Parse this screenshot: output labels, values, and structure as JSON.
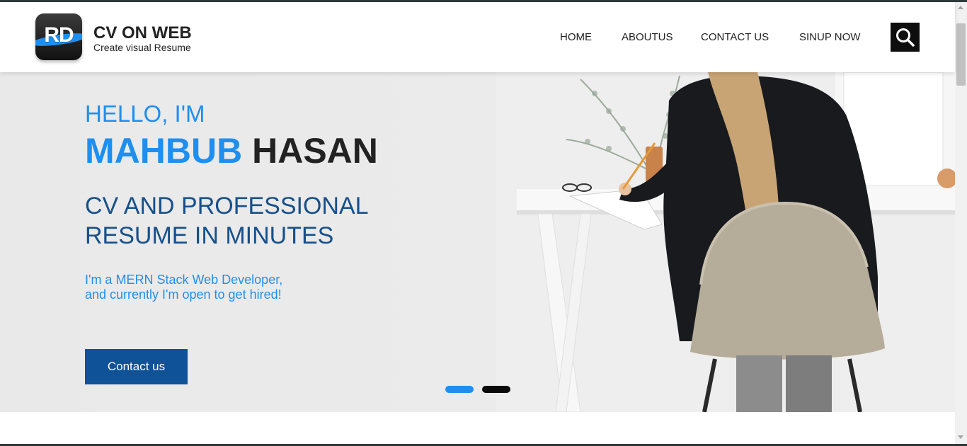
{
  "brand": {
    "logo_letters": "RD",
    "name": "CV ON WEB",
    "tagline": "Create visual Resume"
  },
  "nav": {
    "items": [
      {
        "label": "HOME"
      },
      {
        "label": "ABOUTUS"
      },
      {
        "label": "CONTACT US"
      },
      {
        "label": "SINUP NOW"
      }
    ],
    "search_icon": "search-icon"
  },
  "hero": {
    "greeting": "HELLO, I'M",
    "first_name": "MAHBUB",
    "last_name": "HASAN",
    "headline_line1": "CV AND PROFESSIONAL",
    "headline_line2": "RESUME IN MINUTES",
    "desc_line1": "I'm a MERN Stack Web Developer,",
    "desc_line2": "and currently I'm open to get hired!",
    "cta_label": "Contact us",
    "slides_total": 2,
    "active_slide": 1
  },
  "colors": {
    "accent": "#1e8ff0",
    "headline": "#17508a",
    "button": "#0f5298",
    "dark": "#222222"
  }
}
